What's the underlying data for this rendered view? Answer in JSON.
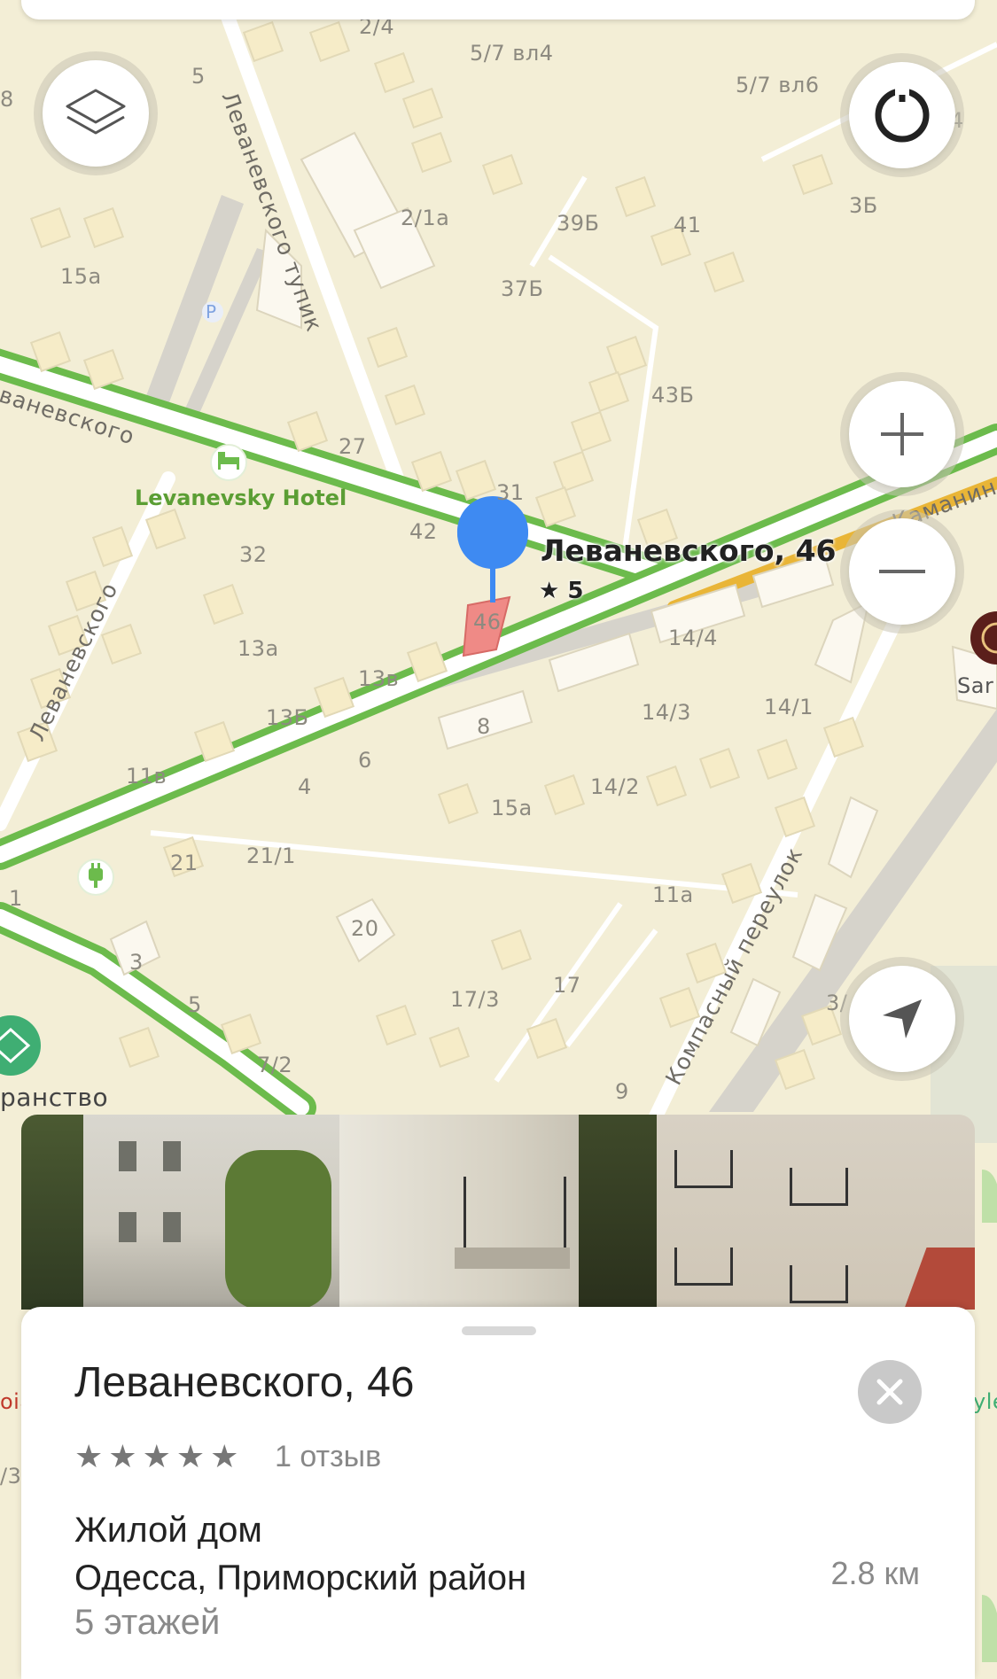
{
  "map": {
    "address_labels": [
      {
        "id": "a1",
        "text": "2/4"
      },
      {
        "id": "a2",
        "text": "5/7 вл4"
      },
      {
        "id": "a3",
        "text": "5/7 вл6"
      },
      {
        "id": "a4",
        "text": "5"
      },
      {
        "id": "a5",
        "text": "8"
      },
      {
        "id": "a6",
        "text": "2/1а"
      },
      {
        "id": "a7",
        "text": "39Б"
      },
      {
        "id": "a8",
        "text": "41"
      },
      {
        "id": "a9",
        "text": "3Б"
      },
      {
        "id": "a10",
        "text": "15а"
      },
      {
        "id": "a11",
        "text": "37Б"
      },
      {
        "id": "a12",
        "text": "43Б"
      },
      {
        "id": "a13",
        "text": "27"
      },
      {
        "id": "a14",
        "text": "31"
      },
      {
        "id": "a15",
        "text": "42"
      },
      {
        "id": "a16",
        "text": "46"
      },
      {
        "id": "a17",
        "text": "32"
      },
      {
        "id": "a18",
        "text": "13а"
      },
      {
        "id": "a19",
        "text": "13в"
      },
      {
        "id": "a20",
        "text": "13Б"
      },
      {
        "id": "a21",
        "text": "14/4"
      },
      {
        "id": "a22",
        "text": "14/3"
      },
      {
        "id": "a23",
        "text": "14/1"
      },
      {
        "id": "a24",
        "text": "8"
      },
      {
        "id": "a25",
        "text": "6"
      },
      {
        "id": "a26",
        "text": "4"
      },
      {
        "id": "a27",
        "text": "11в"
      },
      {
        "id": "a28",
        "text": "14/2"
      },
      {
        "id": "a29",
        "text": "15а"
      },
      {
        "id": "a30",
        "text": "21"
      },
      {
        "id": "a31",
        "text": "21/1"
      },
      {
        "id": "a32",
        "text": "1"
      },
      {
        "id": "a33",
        "text": "11а"
      },
      {
        "id": "a34",
        "text": "20"
      },
      {
        "id": "a35",
        "text": "3"
      },
      {
        "id": "a36",
        "text": "5"
      },
      {
        "id": "a37",
        "text": "17/3"
      },
      {
        "id": "a38",
        "text": "17"
      },
      {
        "id": "a39",
        "text": "7/2"
      },
      {
        "id": "a40",
        "text": "9"
      },
      {
        "id": "a41",
        "text": "3/"
      },
      {
        "id": "a42",
        "text": "4"
      },
      {
        "id": "a43",
        "text": "Sar"
      },
      {
        "id": "a44",
        "text": "ранство"
      },
      {
        "id": "a45",
        "text": "oia"
      },
      {
        "id": "a46",
        "text": "yle"
      },
      {
        "id": "a47",
        "text": "/3"
      }
    ],
    "streets": {
      "levanevsky_tupik": "Леваневского тупик",
      "levanevsky_top": "ваневского",
      "levanevsky_left": "Леваневского",
      "kamanin": "Каманин",
      "kompasny": "Компасный переулок"
    },
    "poi": {
      "hotel": "Levanevsky Hotel",
      "parking": "P"
    },
    "pin": {
      "title": "Леваневского, 46",
      "rating": "★ 5"
    },
    "colors": {
      "map_bg": "#f3eed6",
      "road_green": "#6cbb4c",
      "road_yellow": "#e9b537",
      "pin_blue": "#3e8af2",
      "building_target": "#ef8a86"
    }
  },
  "controls": {
    "layers_icon": "layers-icon",
    "compass_icon": "compass-icon",
    "zoom_in_icon": "plus-icon",
    "zoom_out_icon": "minus-icon",
    "locate_icon": "navigation-arrow-icon"
  },
  "card": {
    "title": "Леваневского, 46",
    "stars": [
      "★",
      "★",
      "★",
      "★",
      "★"
    ],
    "reviews": "1 отзыв",
    "type": "Жилой дом",
    "location": "Одесса, Приморский район",
    "distance": "2.8 км",
    "floors": "5 этажей"
  }
}
